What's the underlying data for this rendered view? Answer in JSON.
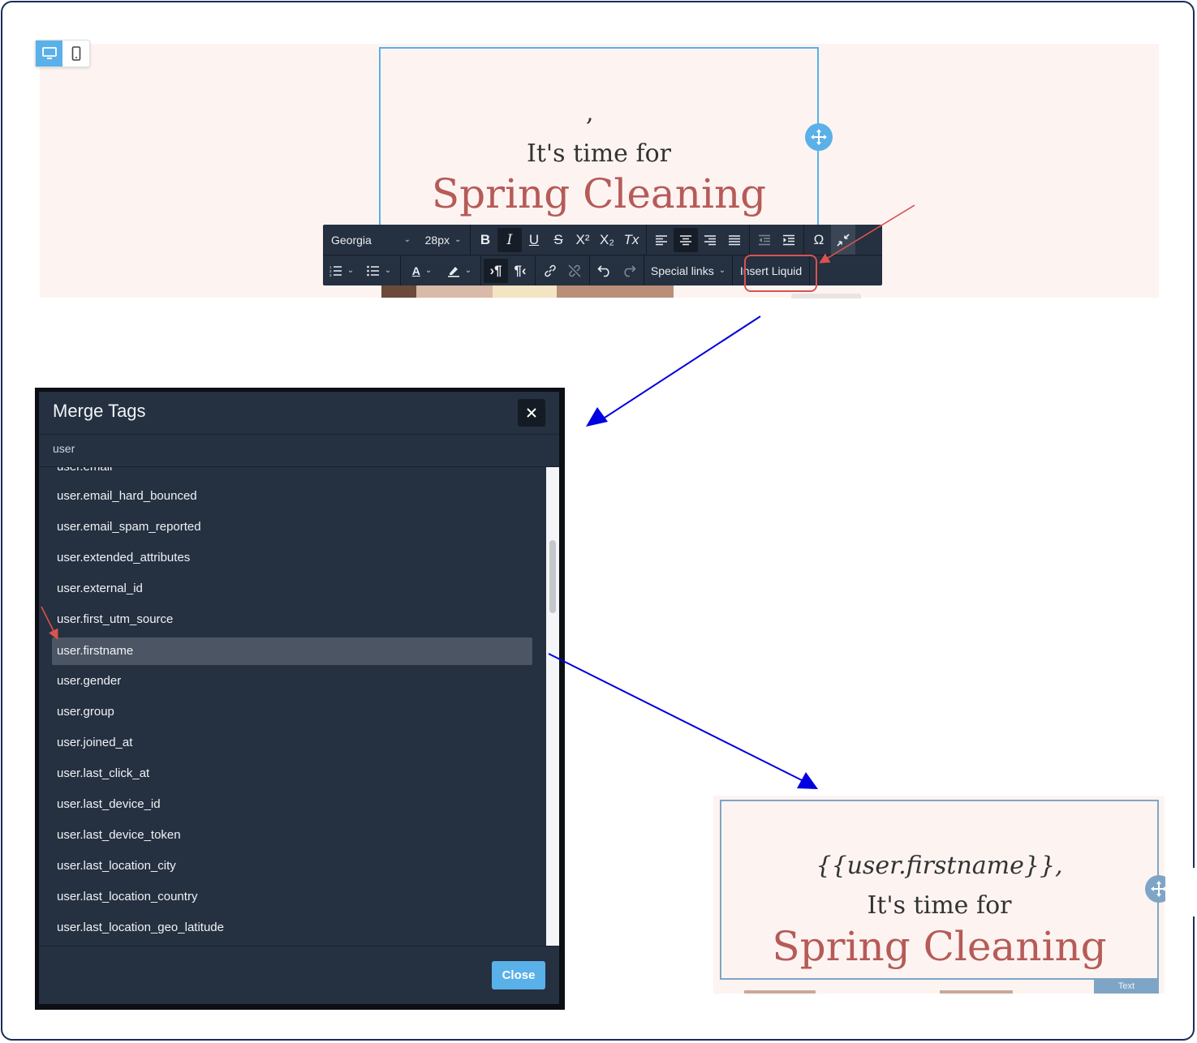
{
  "editor": {
    "device_toggle": {
      "desktop_icon": "monitor-icon",
      "mobile_icon": "phone-icon",
      "active": "desktop"
    },
    "content": {
      "cursor_text": ",",
      "subtitle": "It's time for",
      "title": "Spring Cleaning"
    },
    "toolbar": {
      "font_family": "Georgia",
      "font_size": "28px",
      "bold": "B",
      "italic": "I",
      "underline": "U",
      "strikethrough": "S",
      "superscript": "X²",
      "subscript": "X₂",
      "clear_format": "Tx",
      "special_char": "Ω",
      "text_color": "A",
      "special_links": "Special links",
      "insert_liquid": "Insert Liquid"
    }
  },
  "modal": {
    "title": "Merge Tags",
    "search_value": "user",
    "tags": [
      "user.email",
      "user.email_hard_bounced",
      "user.email_spam_reported",
      "user.extended_attributes",
      "user.external_id",
      "user.first_utm_source",
      "user.firstname",
      "user.gender",
      "user.group",
      "user.joined_at",
      "user.last_click_at",
      "user.last_device_id",
      "user.last_device_token",
      "user.last_location_city",
      "user.last_location_country",
      "user.last_location_geo_latitude"
    ],
    "selected_tag": "user.firstname",
    "close_label": "Close"
  },
  "result": {
    "greeting": "{{user.firstname}},",
    "subtitle": "It's time for",
    "title": "Spring Cleaning",
    "badge": "Text"
  },
  "colors": {
    "accent": "#5ab0e8",
    "title_red": "#b65b57",
    "toolbar_bg": "#253040",
    "annotation_red": "#d9534f",
    "annotation_blue": "#0000e0"
  }
}
